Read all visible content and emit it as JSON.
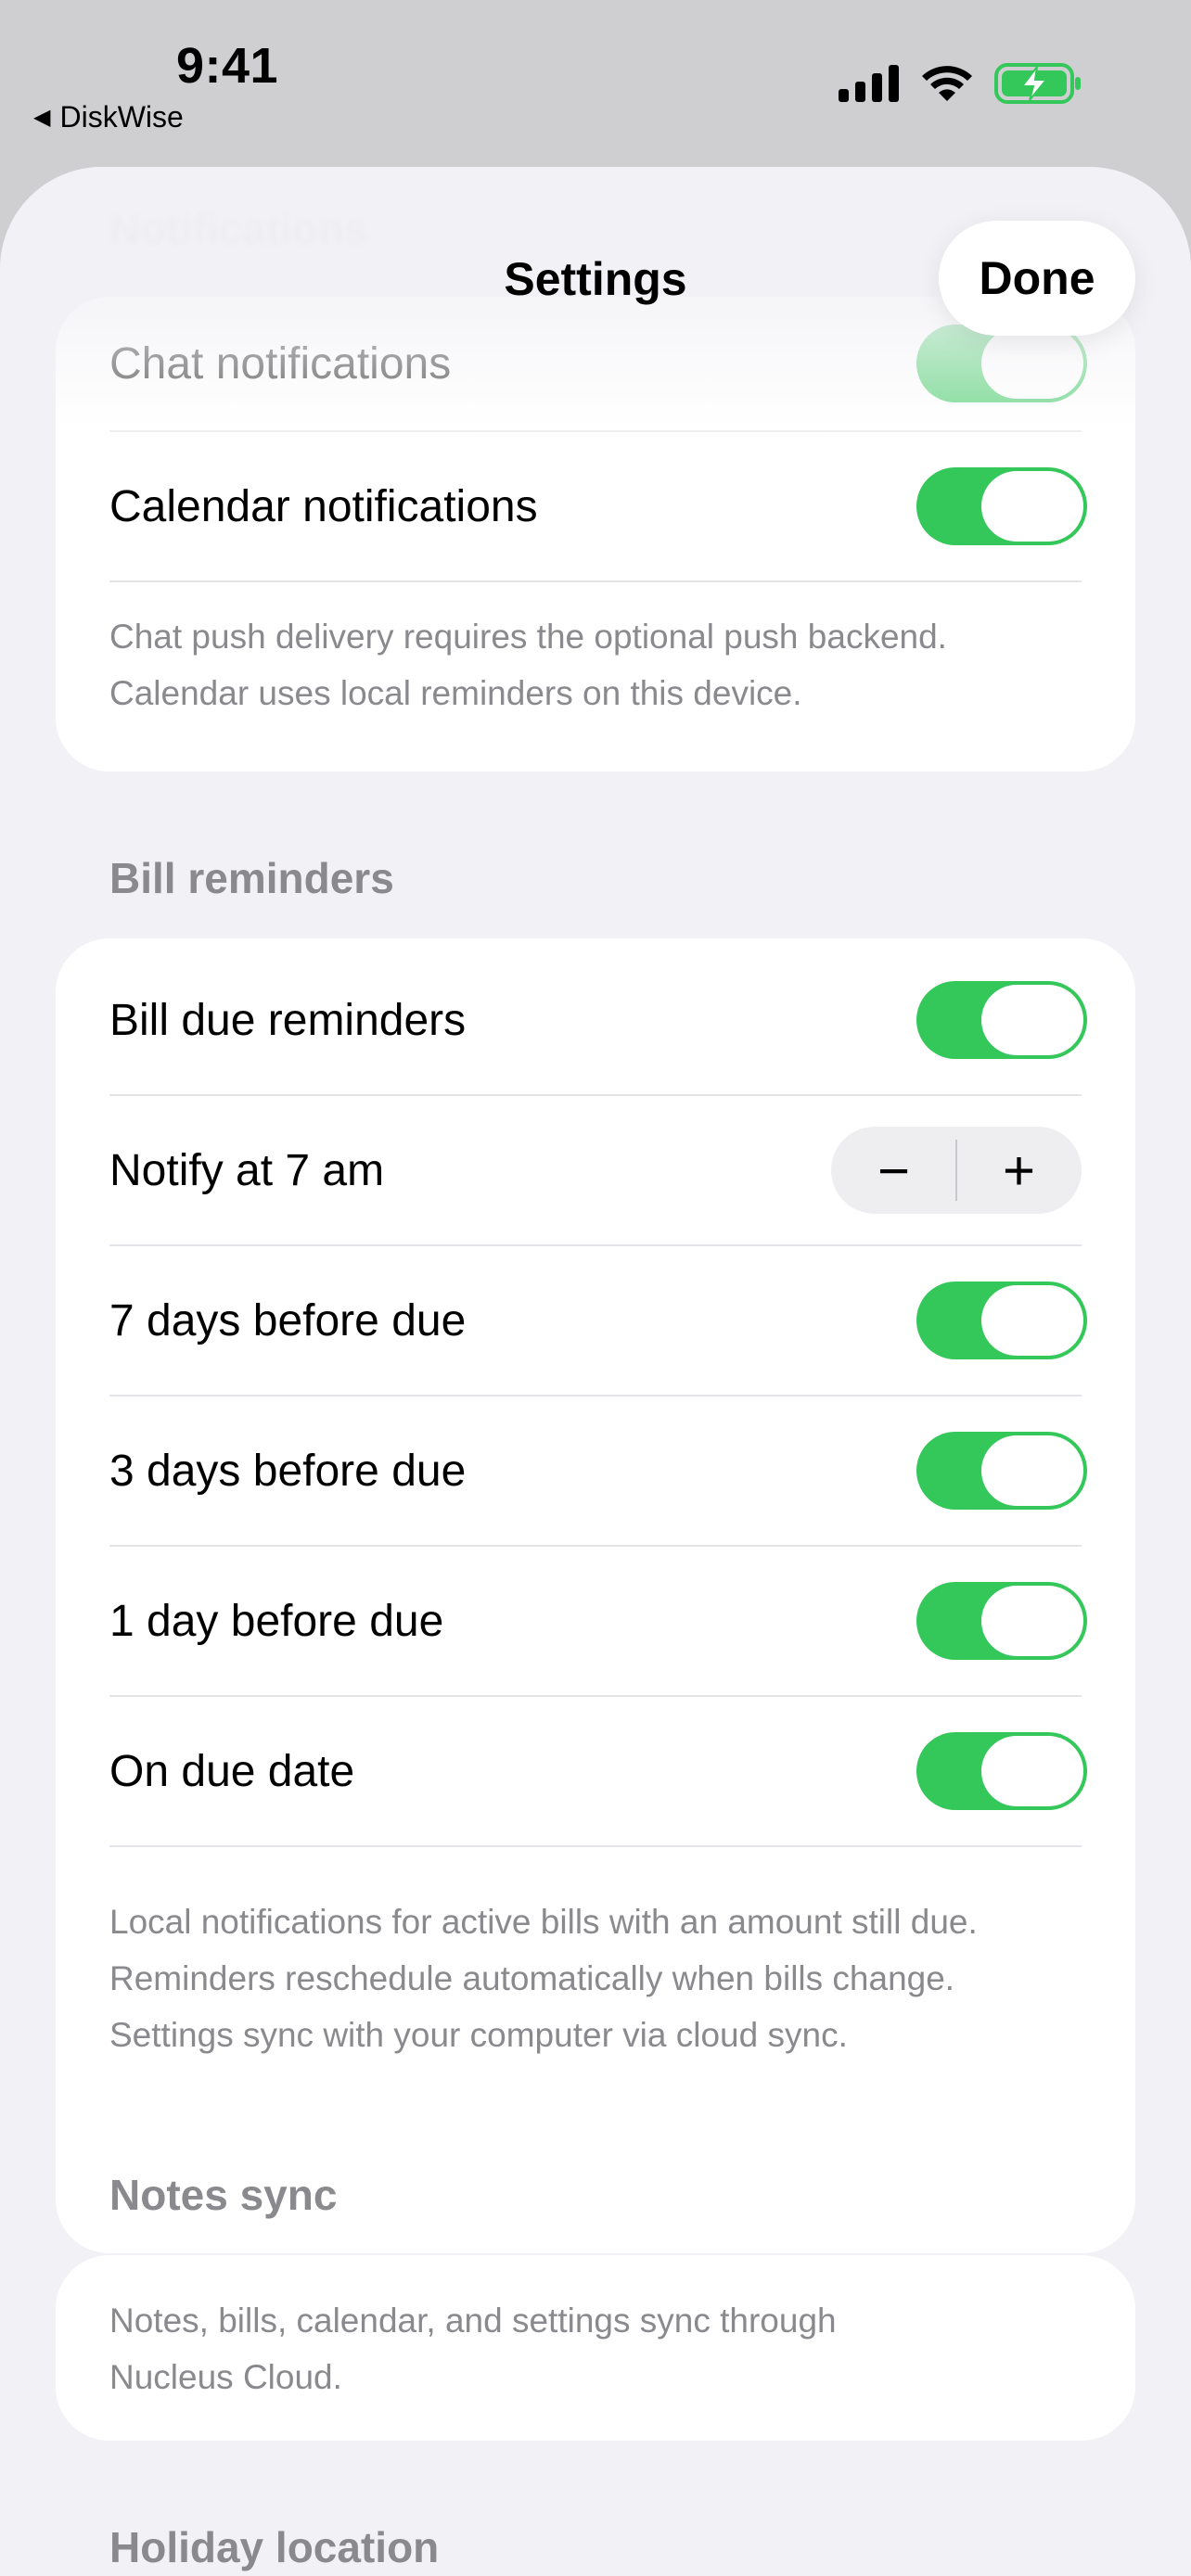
{
  "status_bar": {
    "time": "9:41",
    "back_app": "DiskWise",
    "back_glyph": "◀",
    "icons": [
      "cellular-signal-icon",
      "wifi-icon",
      "battery-charging-icon"
    ],
    "battery_color": "#34c759"
  },
  "nav": {
    "title": "Settings",
    "done_label": "Done",
    "ghost_header": "Notifications"
  },
  "notifications": {
    "rows": [
      {
        "label": "Chat notifications",
        "on": true
      },
      {
        "label": "Calendar notifications",
        "on": true
      }
    ],
    "footnote_lines": [
      "Chat push delivery requires the optional push backend.",
      "Calendar uses local reminders on this device."
    ]
  },
  "bill_reminders": {
    "header": "Bill reminders",
    "rows": [
      {
        "label": "Bill due reminders",
        "on": true
      },
      {
        "label": "Notify at 7 am",
        "control": "stepper",
        "minus": "−",
        "plus": "+"
      },
      {
        "label": "7 days before due",
        "on": true
      },
      {
        "label": "3 days before due",
        "on": true
      },
      {
        "label": "1 day before due",
        "on": true
      },
      {
        "label": "On due date",
        "on": true
      }
    ],
    "footnote_lines": [
      "Local notifications for active bills with an amount still due.",
      "Reminders reschedule automatically when bills change.",
      "Settings sync with your computer via cloud sync."
    ]
  },
  "notes_sync": {
    "header": "Notes sync",
    "footnote_lines": [
      "Notes, bills, calendar, and settings sync through",
      "Nucleus Cloud."
    ]
  },
  "holiday_location": {
    "header": "Holiday location"
  },
  "colors": {
    "toggle_on": "#34c759",
    "background": "#f2f2f6",
    "card": "#ffffff",
    "secondary_text": "#8a8a8e"
  }
}
